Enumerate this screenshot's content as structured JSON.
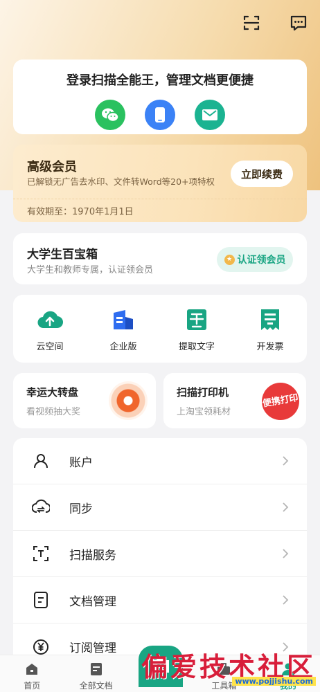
{
  "header": {
    "icons": [
      "scan-icon",
      "message-icon"
    ]
  },
  "login": {
    "title": "登录扫描全能王，管理文档更便捷",
    "methods": [
      "wechat-icon",
      "phone-icon",
      "mail-icon"
    ]
  },
  "vip": {
    "title": "高级会员",
    "desc": "已解锁无广告去水印、文件转Word等20+项特权",
    "button": "立即续费",
    "expire": "有效期至：1970年1月1日"
  },
  "student": {
    "title": "大学生百宝箱",
    "desc": "大学生和教师专属，认证领会员",
    "button": "认证领会员"
  },
  "tools": [
    {
      "label": "云空间",
      "icon": "cloud-upload-icon"
    },
    {
      "label": "企业版",
      "icon": "building-icon"
    },
    {
      "label": "提取文字",
      "icon": "text-extract-icon"
    },
    {
      "label": "开发票",
      "icon": "invoice-icon"
    }
  ],
  "promos": {
    "left": {
      "title": "幸运大转盘",
      "sub": "看视频抽大奖"
    },
    "right": {
      "title": "扫描打印机",
      "sub": "上淘宝领耗材",
      "badge": "便携打印"
    }
  },
  "menu": [
    {
      "label": "账户",
      "icon": "user-icon"
    },
    {
      "label": "同步",
      "icon": "cloud-sync-icon"
    },
    {
      "label": "扫描服务",
      "icon": "scan-frame-icon"
    },
    {
      "label": "文档管理",
      "icon": "document-icon"
    },
    {
      "label": "订阅管理",
      "icon": "yen-icon"
    }
  ],
  "tabs": [
    {
      "label": "首页",
      "icon": "home-icon"
    },
    {
      "label": "全部文档",
      "icon": "files-icon"
    },
    {
      "label": "",
      "icon": "camera-icon"
    },
    {
      "label": "工具箱",
      "icon": "toolbox-icon"
    },
    {
      "label": "我的",
      "icon": "profile-icon"
    }
  ],
  "watermark": {
    "main": "偏爱技术社区",
    "url": "www.pojjishu.com"
  },
  "colors": {
    "accent": "#19a583",
    "gold_bg": "#f6dcae",
    "wechat": "#2ac15f",
    "phone": "#3b82f6",
    "mail": "#1bb391"
  }
}
